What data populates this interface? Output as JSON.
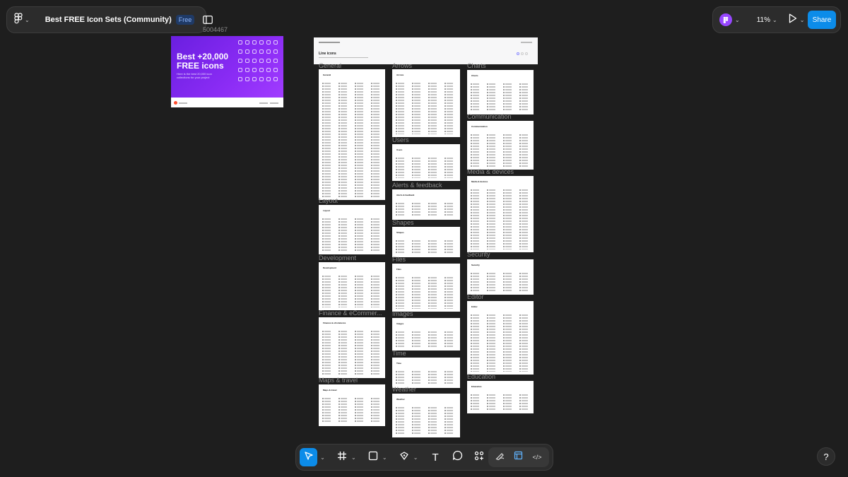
{
  "file": {
    "title": "Best FREE Icon Sets (Community)",
    "plan_badge": "Free",
    "logo_icon": "figma-logo-icon",
    "panel_toggle_icon": "sidebar-toggle-icon"
  },
  "topbar_right": {
    "avatar_icon": "figma-user-avatar-icon",
    "zoom": "11%",
    "present_icon": "play-icon",
    "share_label": "Share",
    "share_color": "#0c8ce9"
  },
  "canvas": {
    "frame_id_label": "5004467",
    "cover": {
      "title_line1": "Best +20,000",
      "title_line2": "FREE icons",
      "subtitle": "Here is the best 20,000 icon collections for your project"
    },
    "header": {
      "title": "Line icons"
    },
    "sections": [
      {
        "label": "General",
        "frame_title": "General"
      },
      {
        "label": "Arrows",
        "frame_title": "Arrows"
      },
      {
        "label": "Charts",
        "frame_title": "Charts"
      },
      {
        "label": "Communication",
        "frame_title": "Communication"
      },
      {
        "label": "Users",
        "frame_title": "Users"
      },
      {
        "label": "Media & devices",
        "frame_title": "Media & devices"
      },
      {
        "label": "Alerts & feedback",
        "frame_title": "Alerts & feedback"
      },
      {
        "label": "Layout",
        "frame_title": "Layout"
      },
      {
        "label": "Shapes",
        "frame_title": "Shapes"
      },
      {
        "label": "Security",
        "frame_title": "Security"
      },
      {
        "label": "Development",
        "frame_title": "Development"
      },
      {
        "label": "Files",
        "frame_title": "Files"
      },
      {
        "label": "Editor",
        "frame_title": "Editor"
      },
      {
        "label": "Finance & eCommer...",
        "frame_title": "Finance & eCommerce"
      },
      {
        "label": "Images",
        "frame_title": "Images"
      },
      {
        "label": "Time",
        "frame_title": "Time"
      },
      {
        "label": "Education",
        "frame_title": "Education"
      },
      {
        "label": "Maps & travel",
        "frame_title": "Maps & travel"
      },
      {
        "label": "Weather",
        "frame_title": "Weather"
      }
    ]
  },
  "toolbar": {
    "tools": [
      {
        "name": "move-tool",
        "icon": "cursor-arrow-icon",
        "active": true
      },
      {
        "name": "frame-tool",
        "icon": "hash-frame-icon",
        "active": false
      },
      {
        "name": "shape-tool",
        "icon": "rectangle-icon",
        "active": false
      },
      {
        "name": "pen-tool",
        "icon": "pen-icon",
        "active": false
      },
      {
        "name": "text-tool",
        "icon": "text-icon",
        "label": "T",
        "active": false
      },
      {
        "name": "comment-tool",
        "icon": "comment-icon",
        "active": false
      },
      {
        "name": "actions-tool",
        "icon": "actions-grid-icon",
        "active": false
      }
    ],
    "modes": [
      {
        "name": "draw-mode",
        "icon": "draw-icon"
      },
      {
        "name": "design-mode",
        "icon": "design-icon"
      },
      {
        "name": "dev-mode",
        "icon": "code-icon",
        "label": "</>"
      }
    ]
  },
  "help_label": "?"
}
